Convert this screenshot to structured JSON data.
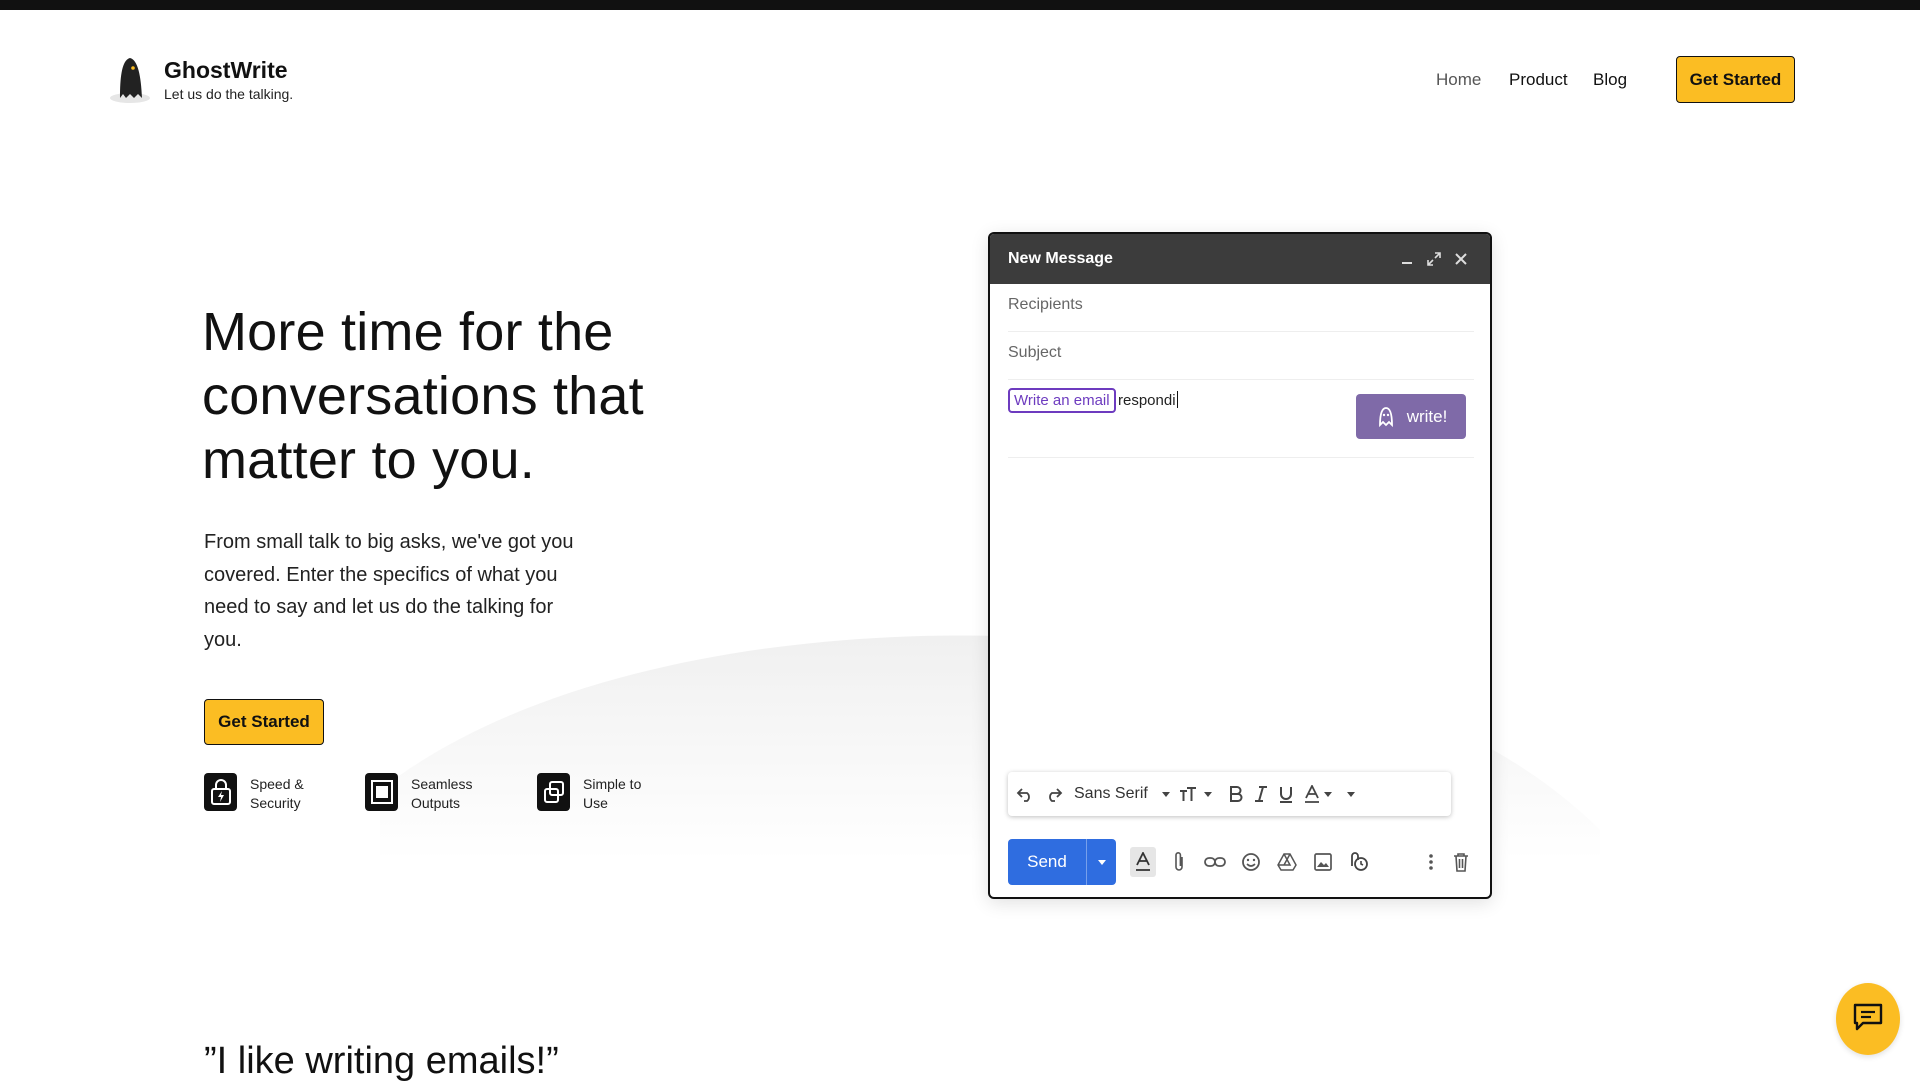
{
  "brand": {
    "name": "GhostWrite",
    "tagline": "Let us do the talking.",
    "logo_icon": "ghost-icon"
  },
  "nav": {
    "links": [
      "Home",
      "Product",
      "Blog"
    ],
    "cta_label": "Get Started"
  },
  "hero": {
    "title": "More time for the conversations that matter to you.",
    "subtitle": "From small talk to big asks, we've got you covered. Enter the specifics of what you need to say and let us do the talking for you.",
    "cta_label": "Get Started",
    "features": [
      {
        "label": "Speed & Security",
        "icon": "lock-bolt-icon"
      },
      {
        "label": "Seamless Outputs",
        "icon": "frame-icon"
      },
      {
        "label": "Simple to Use",
        "icon": "copy-icon"
      }
    ]
  },
  "compose": {
    "title": "New Message",
    "recipients_placeholder": "Recipients",
    "subject_placeholder": "Subject",
    "chip_label": "Write an email",
    "typed_text": "respondi",
    "write_button_label": "write!",
    "font_name": "Sans Serif",
    "send_label": "Send"
  },
  "testimonial": {
    "quote": "”I like writing emails!”"
  },
  "colors": {
    "accent_yellow": "#fbbd23",
    "compose_header": "#3c3c3c",
    "send_blue": "#2f6de0",
    "write_purple": "#7f6aa8",
    "chip_purple": "#6d3bbf"
  }
}
